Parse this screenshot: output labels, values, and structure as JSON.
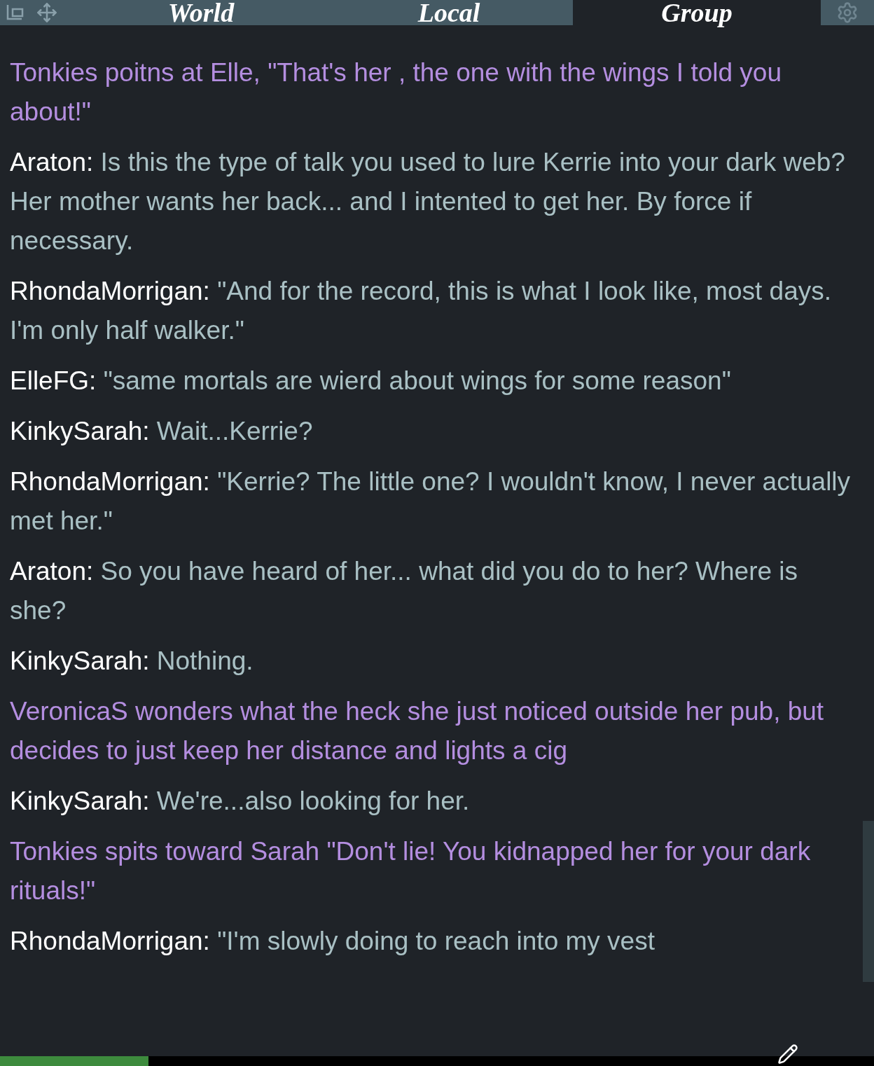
{
  "tabs": [
    {
      "label": "World",
      "selected": false
    },
    {
      "label": "Local",
      "selected": false
    },
    {
      "label": "Group",
      "selected": true
    }
  ],
  "messages": [
    {
      "kind": "emote",
      "text": "Tonkies poitns at Elle, \"That's her , the one with the wings I told you about!\""
    },
    {
      "kind": "say",
      "name": "Araton:",
      "text": "Is this the type of talk you used to lure Kerrie into your dark web? Her mother wants her back... and I intented to get her. By force if necessary."
    },
    {
      "kind": "say",
      "name": "RhondaMorrigan:",
      "text": "\"And for the record, this is what I look like, most days.  I'm only half walker.\""
    },
    {
      "kind": "say",
      "name": "ElleFG:",
      "text": "\"same mortals are wierd about wings for some reason\""
    },
    {
      "kind": "say",
      "name": "KinkySarah:",
      "text": "Wait...Kerrie?"
    },
    {
      "kind": "say",
      "name": "RhondaMorrigan:",
      "text": "\"Kerrie?  The little one?  I wouldn't know, I never actually met her.\""
    },
    {
      "kind": "say",
      "name": "Araton:",
      "text": "So you have heard of her... what did you do to her? Where is she?"
    },
    {
      "kind": "say",
      "name": "KinkySarah:",
      "text": "Nothing."
    },
    {
      "kind": "emote",
      "text": "VeronicaS wonders what the heck she just noticed outside her pub, but decides to just keep her distance and lights a cig"
    },
    {
      "kind": "say",
      "name": "KinkySarah:",
      "text": "We're...also looking for her."
    },
    {
      "kind": "emote",
      "text": "Tonkies spits toward Sarah \"Don't lie! You kidnapped her for your dark rituals!\""
    },
    {
      "kind": "say",
      "name": "RhondaMorrigan:",
      "text": "\"I'm slowly doing to reach into my vest"
    }
  ],
  "status_bar": {
    "level": 0.17
  }
}
